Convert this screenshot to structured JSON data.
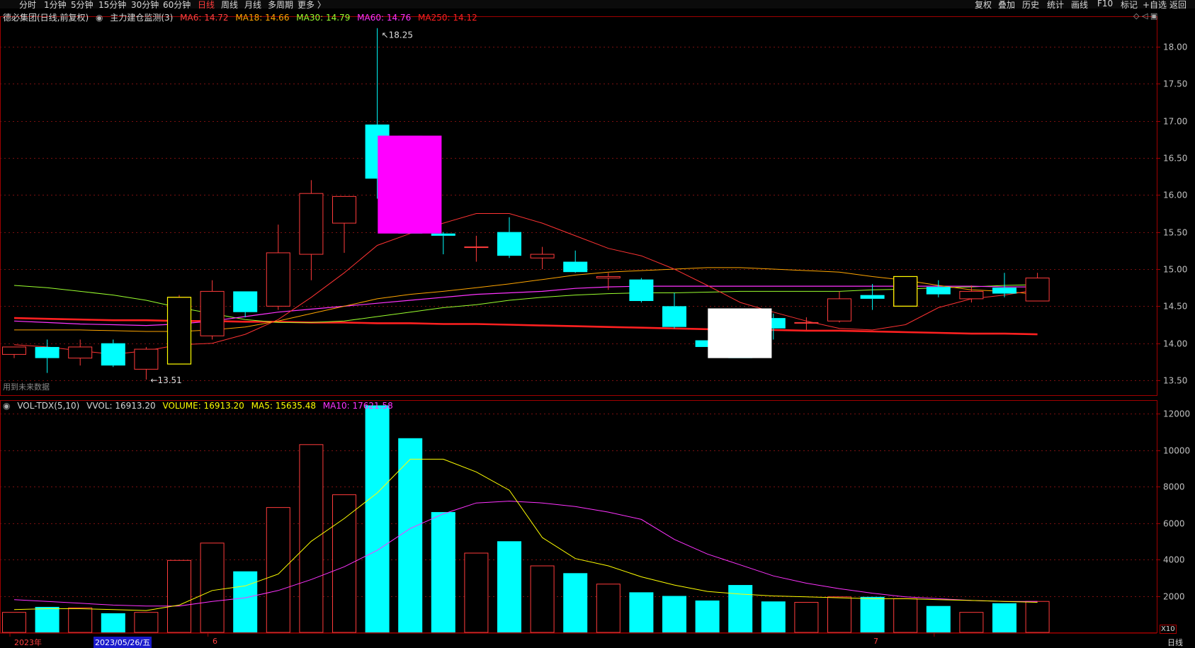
{
  "toolbar": {
    "left_items": [
      "分时",
      "1分钟",
      "5分钟",
      "15分钟",
      "30分钟",
      "60分钟",
      "日线",
      "周线",
      "月线",
      "多周期",
      "更多 〉"
    ],
    "active_item": "日线",
    "right_items": [
      "复权",
      "叠加",
      "历史",
      "统计",
      "画线",
      "F10",
      "标记",
      "+自选",
      "返回"
    ]
  },
  "price_legend": {
    "stock": "德必集团(日线,前复权)",
    "indicator": "主力建仓监测(3)",
    "ma6": "MA6: 14.72",
    "ma18": "MA18: 14.66",
    "ma30": "MA30: 14.79",
    "ma60": "MA60: 14.76",
    "ma250": "MA250: 14.12"
  },
  "volume_legend": {
    "name": "VOL-TDX(5,10)",
    "vvol": "VVOL: 16913.20",
    "volume": "VOLUME: 16913.20",
    "ma5": "MA5: 15635.48",
    "ma10": "MA10: 17621.58"
  },
  "future_data_note": "用到未来数据",
  "x_labels": {
    "year": "2023年",
    "date_cursor": "2023/05/26/五",
    "month6": "6",
    "month7": "7"
  },
  "period_label": "日线",
  "volume_unit": "X10",
  "colors": {
    "up": "#ff3b3b",
    "down": "#00ffff",
    "ma6": "#ff3333",
    "ma18": "#ffa500",
    "ma30": "#9aff2e",
    "ma60": "#ff33ff",
    "ma250": "#ff2020",
    "vol_ma5": "#ffff00",
    "vol_ma10": "#ff33ff",
    "grid": "#7a1010",
    "axis": "#a00000"
  },
  "chart_data": [
    {
      "type": "candlestick",
      "title": "德必集团(日线,前复权)",
      "ylim": [
        13.3,
        18.4
      ],
      "yticks": [
        13.5,
        14.0,
        14.5,
        15.0,
        15.5,
        16.0,
        16.5,
        17.0,
        17.5,
        18.0
      ],
      "ytick_labels": [
        "13.50",
        "14.00",
        "14.50",
        "15.00",
        "15.50",
        "16.00",
        "16.50",
        "17.00",
        "17.50",
        "18.00"
      ],
      "annotations": [
        {
          "text": "18.25",
          "value": 18.25,
          "bar": 11
        },
        {
          "text": "13.51",
          "value": 13.51,
          "bar": 4
        }
      ],
      "candles": [
        {
          "o": 13.85,
          "h": 13.95,
          "l": 13.8,
          "c": 13.95
        },
        {
          "o": 13.95,
          "h": 14.05,
          "l": 13.6,
          "c": 13.8
        },
        {
          "o": 13.8,
          "h": 14.05,
          "l": 13.7,
          "c": 13.95
        },
        {
          "o": 14.0,
          "h": 14.05,
          "l": 13.68,
          "c": 13.7
        },
        {
          "o": 13.65,
          "h": 13.95,
          "l": 13.51,
          "c": 13.92
        },
        {
          "o": 13.72,
          "h": 14.65,
          "l": 13.72,
          "c": 14.62
        },
        {
          "o": 14.1,
          "h": 14.85,
          "l": 14.05,
          "c": 14.7
        },
        {
          "o": 14.7,
          "h": 14.7,
          "l": 14.35,
          "c": 14.42
        },
        {
          "o": 14.5,
          "h": 15.6,
          "l": 14.45,
          "c": 15.22
        },
        {
          "o": 15.2,
          "h": 16.2,
          "l": 14.85,
          "c": 16.02
        },
        {
          "o": 15.62,
          "h": 15.98,
          "l": 15.22,
          "c": 15.98
        },
        {
          "o": 16.95,
          "h": 18.25,
          "l": 15.95,
          "c": 16.22
        },
        {
          "o": 16.8,
          "h": 16.8,
          "l": 15.48,
          "c": 15.48
        },
        {
          "o": 15.48,
          "h": 15.5,
          "l": 15.2,
          "c": 15.45
        },
        {
          "o": 15.3,
          "h": 15.45,
          "l": 15.1,
          "c": 15.3
        },
        {
          "o": 15.5,
          "h": 15.7,
          "l": 15.15,
          "c": 15.18
        },
        {
          "o": 15.15,
          "h": 15.3,
          "l": 15.0,
          "c": 15.2
        },
        {
          "o": 15.1,
          "h": 15.25,
          "l": 14.95,
          "c": 14.96
        },
        {
          "o": 14.88,
          "h": 14.95,
          "l": 14.72,
          "c": 14.9
        },
        {
          "o": 14.86,
          "h": 14.88,
          "l": 14.55,
          "c": 14.57
        },
        {
          "o": 14.5,
          "h": 14.68,
          "l": 14.2,
          "c": 14.22
        },
        {
          "o": 14.04,
          "h": 14.04,
          "l": 13.95,
          "c": 13.95
        },
        {
          "o": 14.47,
          "h": 14.47,
          "l": 13.8,
          "c": 13.8
        },
        {
          "o": 14.34,
          "h": 14.4,
          "l": 14.05,
          "c": 14.2
        },
        {
          "o": 14.27,
          "h": 14.35,
          "l": 14.18,
          "c": 14.28
        },
        {
          "o": 14.3,
          "h": 14.7,
          "l": 14.28,
          "c": 14.6
        },
        {
          "o": 14.65,
          "h": 14.8,
          "l": 14.45,
          "c": 14.6
        },
        {
          "o": 14.5,
          "h": 14.9,
          "l": 14.5,
          "c": 14.9
        },
        {
          "o": 14.76,
          "h": 14.85,
          "l": 14.62,
          "c": 14.66
        },
        {
          "o": 14.6,
          "h": 14.78,
          "l": 14.55,
          "c": 14.7
        },
        {
          "o": 14.75,
          "h": 14.95,
          "l": 14.62,
          "c": 14.67
        },
        {
          "o": 14.57,
          "h": 14.95,
          "l": 14.57,
          "c": 14.88
        }
      ],
      "series": [
        {
          "name": "MA6",
          "values": [
            13.98,
            13.95,
            13.9,
            13.85,
            13.9,
            13.98,
            14.0,
            14.12,
            14.32,
            14.62,
            14.95,
            15.32,
            15.48,
            15.62,
            15.75,
            15.75,
            15.62,
            15.45,
            15.28,
            15.18,
            15.0,
            14.78,
            14.55,
            14.42,
            14.3,
            14.2,
            14.18,
            14.25,
            14.48,
            14.6,
            14.65,
            14.72
          ]
        },
        {
          "name": "MA18",
          "values": [
            14.18,
            14.18,
            14.18,
            14.17,
            14.16,
            14.16,
            14.18,
            14.22,
            14.3,
            14.4,
            14.5,
            14.6,
            14.66,
            14.7,
            14.75,
            14.8,
            14.86,
            14.92,
            14.96,
            14.98,
            15.0,
            15.02,
            15.02,
            15.0,
            14.98,
            14.96,
            14.9,
            14.85,
            14.78,
            14.72,
            14.7,
            14.66
          ]
        },
        {
          "name": "MA30",
          "values": [
            14.78,
            14.75,
            14.7,
            14.65,
            14.58,
            14.48,
            14.4,
            14.32,
            14.28,
            14.28,
            14.3,
            14.36,
            14.42,
            14.48,
            14.52,
            14.58,
            14.62,
            14.65,
            14.67,
            14.68,
            14.68,
            14.69,
            14.7,
            14.7,
            14.7,
            14.7,
            14.72,
            14.73,
            14.75,
            14.76,
            14.78,
            14.79
          ]
        },
        {
          "name": "MA60",
          "values": [
            14.3,
            14.28,
            14.26,
            14.25,
            14.24,
            14.26,
            14.3,
            14.36,
            14.42,
            14.46,
            14.5,
            14.54,
            14.58,
            14.62,
            14.66,
            14.68,
            14.7,
            14.74,
            14.76,
            14.77,
            14.77,
            14.77,
            14.77,
            14.77,
            14.77,
            14.77,
            14.77,
            14.77,
            14.77,
            14.77,
            14.76,
            14.76
          ]
        },
        {
          "name": "MA250",
          "values": [
            14.34,
            14.33,
            14.32,
            14.31,
            14.31,
            14.3,
            14.3,
            14.29,
            14.29,
            14.28,
            14.28,
            14.27,
            14.27,
            14.26,
            14.26,
            14.25,
            14.24,
            14.23,
            14.22,
            14.21,
            14.2,
            14.19,
            14.18,
            14.18,
            14.17,
            14.17,
            14.16,
            14.15,
            14.14,
            14.13,
            14.13,
            14.12
          ]
        }
      ]
    },
    {
      "type": "bar",
      "title": "VOL-TDX(5,10)",
      "ylim": [
        0,
        12700
      ],
      "yticks": [
        2000,
        4000,
        6000,
        8000,
        10000,
        12000
      ],
      "ytick_labels": [
        "2000",
        "4000",
        "6000",
        "8000",
        "10000",
        "12000"
      ],
      "values": [
        1100,
        1400,
        1350,
        1050,
        1100,
        3950,
        4900,
        3350,
        6850,
        10300,
        7550,
        12450,
        10650,
        6600,
        4350,
        5000,
        3650,
        3250,
        2650,
        2200,
        2000,
        1750,
        2600,
        1700,
        1650,
        1950,
        1950,
        1850,
        1450,
        1100,
        1600,
        1700
      ],
      "series": [
        {
          "name": "MA5",
          "values": [
            1250,
            1300,
            1300,
            1250,
            1200,
            1500,
            2300,
            2550,
            3200,
            5000,
            6250,
            7650,
            9500,
            9500,
            8800,
            7800,
            5200,
            4050,
            3650,
            3050,
            2600,
            2250,
            2100,
            2000,
            1950,
            1900,
            1850,
            1850,
            1800,
            1750,
            1700,
            1650
          ]
        },
        {
          "name": "MA10",
          "values": [
            1800,
            1700,
            1600,
            1500,
            1450,
            1450,
            1700,
            1900,
            2300,
            2900,
            3600,
            4500,
            5700,
            6500,
            7100,
            7200,
            7100,
            6900,
            6600,
            6200,
            5100,
            4300,
            3700,
            3100,
            2700,
            2400,
            2150,
            1950,
            1850,
            1750,
            1700,
            1700
          ]
        }
      ]
    }
  ]
}
